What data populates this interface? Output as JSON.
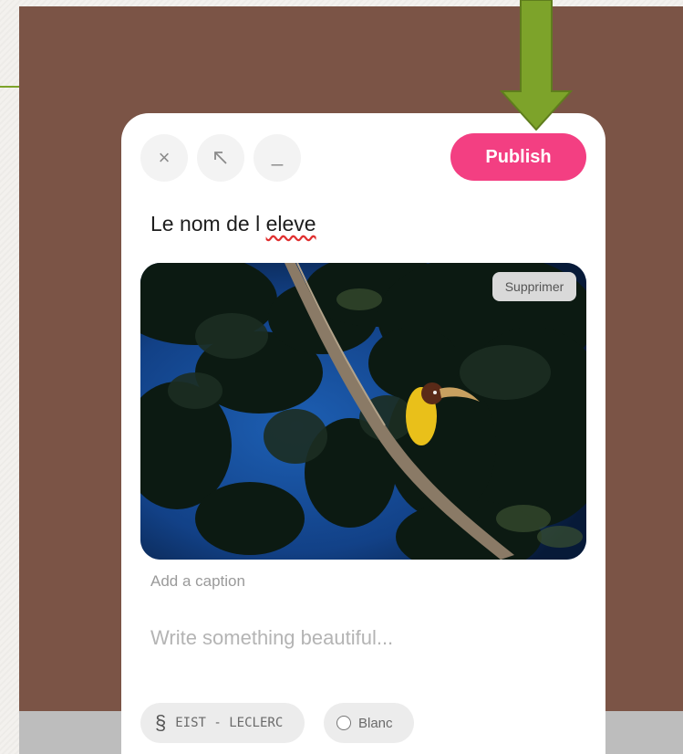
{
  "editor": {
    "publish_label": "Publish",
    "title": "Le nom de l ",
    "title_flagged_word": "eleve",
    "caption_placeholder": "Add a caption",
    "body_placeholder": "Write something beautiful...",
    "delete_image_label": "Supprimer"
  },
  "toolbar": {
    "close_icon": "×",
    "expand_icon": "⇱",
    "minimize_icon": "_"
  },
  "chips": {
    "category_icon": "§",
    "category_label": "EIST - LECLERC",
    "color_label": "Blanc"
  },
  "colors": {
    "backdrop": "#7b5446",
    "publish": "#f33f82",
    "arrow": "#7da32a"
  }
}
